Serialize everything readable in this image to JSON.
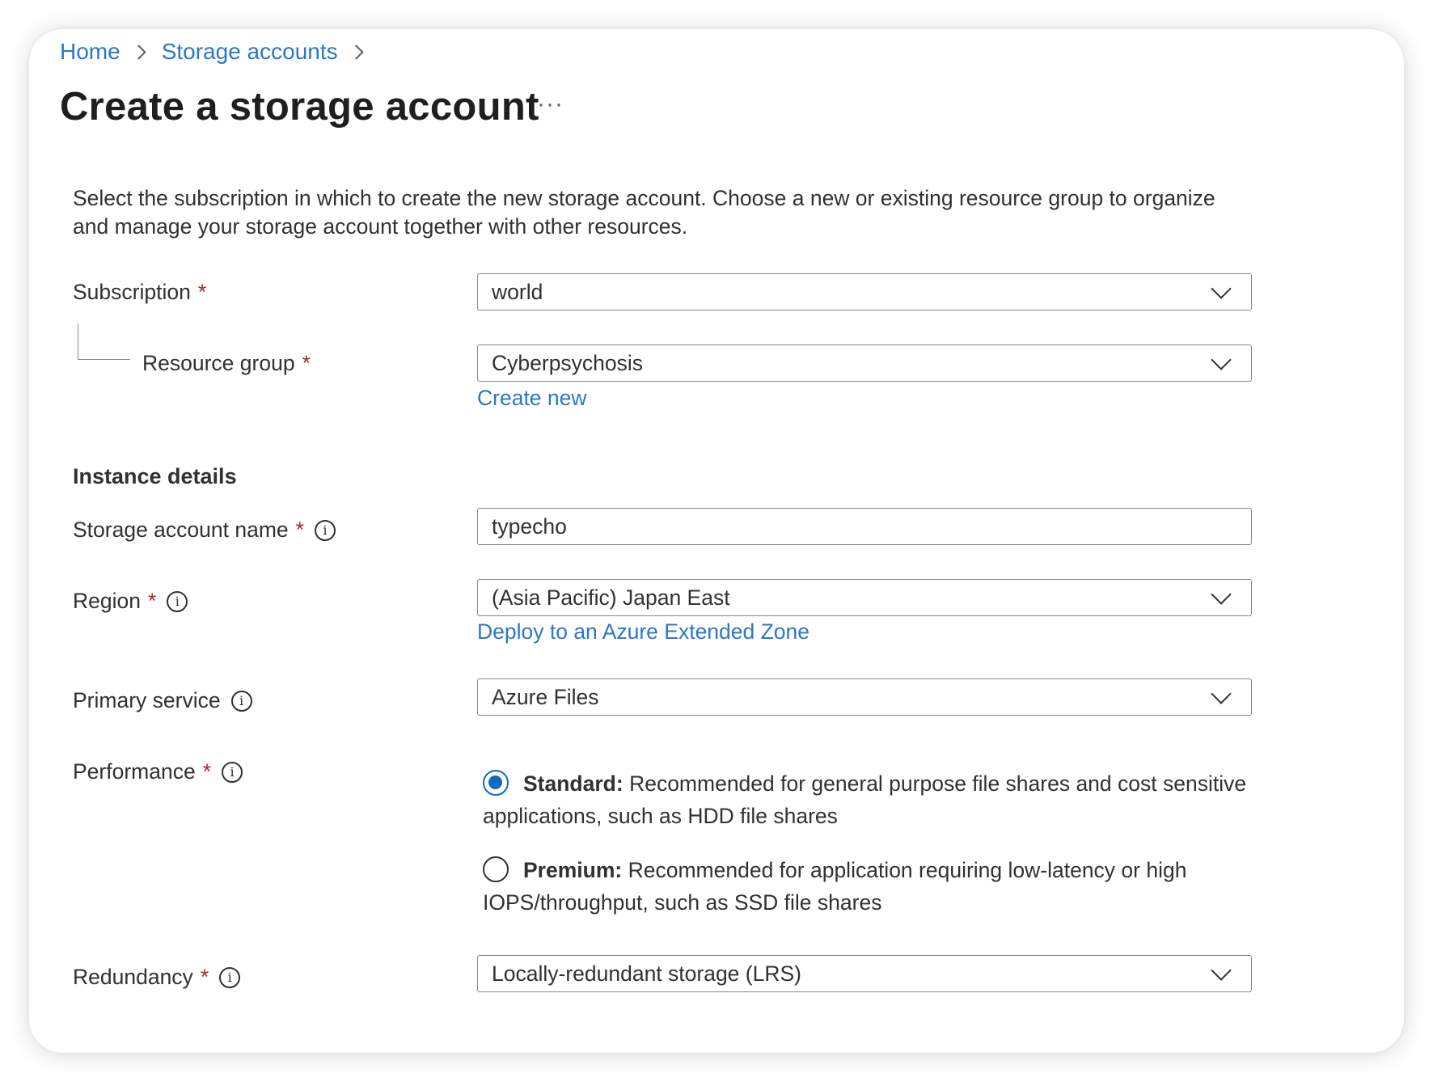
{
  "breadcrumb": {
    "items": [
      "Home",
      "Storage accounts"
    ]
  },
  "page": {
    "title": "Create a storage account",
    "more_label": "···",
    "intro": "Select the subscription in which to create the new storage account. Choose a new or existing resource group to organize and manage your storage account together with other resources."
  },
  "form": {
    "subscription": {
      "label": "Subscription",
      "required": "*",
      "value": "world"
    },
    "resource_group": {
      "label": "Resource group",
      "required": "*",
      "value": "Cyberpsychosis",
      "link": "Create new"
    },
    "instance_section": "Instance details",
    "storage_name": {
      "label": "Storage account name",
      "required": "*",
      "value": "typecho",
      "info": "i"
    },
    "region": {
      "label": "Region",
      "required": "*",
      "value": "(Asia Pacific) Japan East",
      "link": "Deploy to an Azure Extended Zone",
      "info": "i"
    },
    "primary_service": {
      "label": "Primary service",
      "value": "Azure Files",
      "info": "i"
    },
    "performance": {
      "label": "Performance",
      "required": "*",
      "info": "i",
      "options": [
        {
          "title": "Standard:",
          "desc": "Recommended for general purpose file shares and cost sensitive applications, such as HDD file shares",
          "selected": true
        },
        {
          "title": "Premium:",
          "desc": "Recommended for application requiring low-latency or high IOPS/throughput, such as SSD file shares",
          "selected": false
        }
      ]
    },
    "redundancy": {
      "label": "Redundancy",
      "required": "*",
      "value": "Locally-redundant storage (LRS)",
      "info": "i"
    }
  },
  "colors": {
    "link": "#2b78c5",
    "required": "#a4262c",
    "accent": "#0f6cbd"
  },
  "icons": {
    "breadcrumb_separator": "chevron-right-icon",
    "dropdown": "chevron-down-icon",
    "info": "info-icon",
    "more": "more-icon"
  }
}
